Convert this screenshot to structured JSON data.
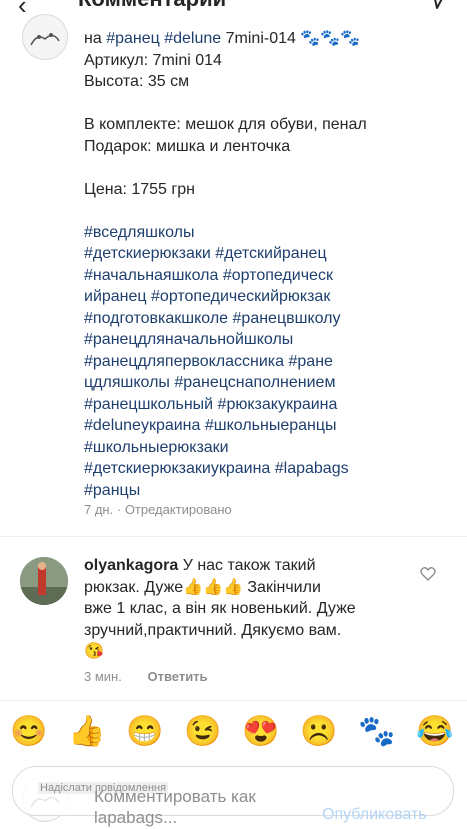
{
  "header": {
    "back_icon": "back-arrow-icon",
    "title": "Комментарии",
    "send_icon": "send-icon"
  },
  "post": {
    "account_icon": "lapabags-logo",
    "lines": [
      [
        "на ",
        "#ранец",
        " ",
        "#delune",
        " 7mini-014 🐾🐾🐾"
      ],
      "Артикул: 7mini 014",
      "Высота: 35 см",
      "",
      "В комплекте: мешок для обуви, пенал",
      "Подарок: мишка и ленточка",
      "",
      "Цена: 1755 грн",
      ""
    ],
    "hashtags": [
      "#вседляшколы",
      "#детскиерюкзаки #детскийранец",
      "#начальнаяшкола #ортопедическ",
      "ийранец #ортопедическийрюкзак",
      "#подготовкакшколе #ранецвшколу",
      "#ранецдляначальнойшколы",
      "#ранецдляпервоклассника #ране",
      "цдляшколы #ранецснаполнением",
      "#ранецшкольный #рюкзакукраина",
      "#deluneукраина  #школьныеранцы",
      "#школьныерюкзаки",
      "#детскиерюкзакиукраина #lapabags",
      "#ранцы"
    ],
    "time": "7 дн.",
    "separator": "·",
    "edited": "Отредактировано"
  },
  "comment": {
    "username": "olyankagora",
    "text_lines": [
      " У нас також такий",
      "рюкзак. Дуже👍👍👍 Закінчили",
      "вже 1 клас, а він як новенький. Дуже",
      "зручний,практичний. Дякуємо  вам.",
      "😘"
    ],
    "time": "3 мин.",
    "reply_label": "Ответить",
    "like_icon": "heart-outline-icon"
  },
  "emoji_bar": [
    "😊",
    "👍",
    "😁",
    "😉",
    "😍",
    "☹️",
    "🐾",
    "😂"
  ],
  "input": {
    "hint": "Надіслати повідомлення",
    "placeholder": "Комментировать как lapabags...",
    "publish_label": "Опубликовать"
  },
  "colors": {
    "hashtag": "#1f3f6e",
    "meta": "#8e8e8e",
    "publish_disabled": "#b3d4f5"
  }
}
